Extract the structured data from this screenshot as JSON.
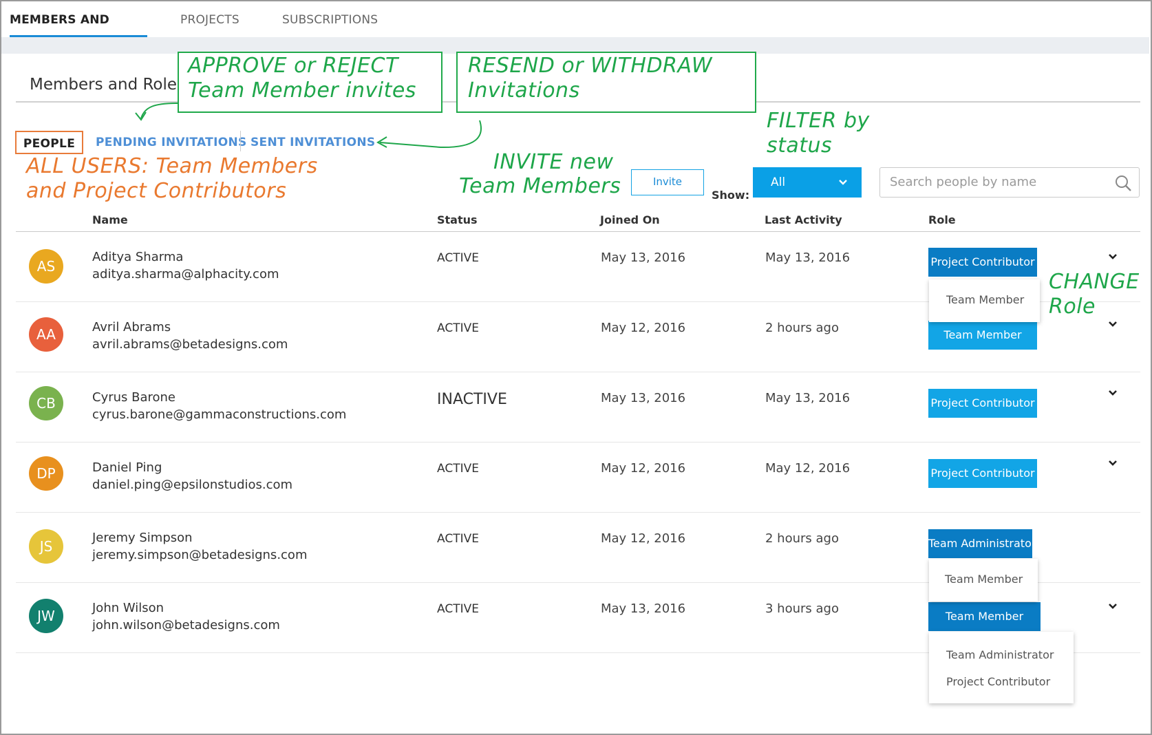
{
  "top_tabs": [
    "MEMBERS AND ROLES",
    "PROJECTS",
    "SUBSCRIPTIONS"
  ],
  "section_title": "Members and Roles",
  "subtabs": {
    "people": "PEOPLE",
    "pending": "PENDING INVITATIONS",
    "sent": "SENT INVITATIONS"
  },
  "toolbar": {
    "invite_label": "Invite",
    "show_label": "Show:",
    "filter_value": "All",
    "search_placeholder": "Search people by name"
  },
  "table": {
    "columns": [
      "Name",
      "Status",
      "Joined On",
      "Last Activity",
      "Role"
    ],
    "rows": [
      {
        "initials": "AS",
        "name": "Aditya Sharma",
        "email": "aditya.sharma@alphacity.com",
        "status": "ACTIVE",
        "joined": "May 13, 2016",
        "last": "May 13, 2016",
        "role": "Project Contributor"
      },
      {
        "initials": "AA",
        "name": "Avril Abrams",
        "email": "avril.abrams@betadesigns.com",
        "status": "ACTIVE",
        "joined": "May 12, 2016",
        "last": "2 hours ago",
        "role": "Team Member"
      },
      {
        "initials": "CB",
        "name": "Cyrus Barone",
        "email": "cyrus.barone@gammaconstructions.com",
        "status": "INACTIVE",
        "joined": "May 13, 2016",
        "last": "May 13, 2016",
        "role": "Project Contributor"
      },
      {
        "initials": "DP",
        "name": "Daniel Ping",
        "email": "daniel.ping@epsilonstudios.com",
        "status": "ACTIVE",
        "joined": "May 12, 2016",
        "last": "May 12, 2016",
        "role": "Project Contributor"
      },
      {
        "initials": "JS",
        "name": "Jeremy Simpson",
        "email": "jeremy.simpson@betadesigns.com",
        "status": "ACTIVE",
        "joined": "May 12, 2016",
        "last": "2 hours ago",
        "role": "Team Administrator"
      },
      {
        "initials": "JW",
        "name": "John Wilson",
        "email": "john.wilson@betadesigns.com",
        "status": "ACTIVE",
        "joined": "May 13, 2016",
        "last": "3 hours ago",
        "role": "Team Member"
      }
    ]
  },
  "dropdowns": {
    "row1": [
      "Team Member"
    ],
    "row5": [
      "Team Member"
    ],
    "row6": [
      "Team Administrator",
      "Project Contributor"
    ]
  },
  "annotations": {
    "approve_1": "APPROVE or REJECT",
    "approve_2": "Team Member invites",
    "resend_1": "RESEND or WITHDRAW",
    "resend_2": "Invitations",
    "filter_1": "FILTER by",
    "filter_2": "status",
    "invite_1": "INVITE new",
    "invite_2": "Team Members",
    "allusers_1": "ALL USERS: Team Members",
    "allusers_2": "and Project Contributors",
    "change_1": "CHANGE",
    "change_2": "Role"
  },
  "colors": {
    "accent": "#0aa0e6",
    "accent_dark": "#0a7cc4",
    "annotation_green": "#1ea64a",
    "annotation_orange": "#e9792f",
    "avatars": [
      "#e9a820",
      "#e8603c",
      "#7ab24e",
      "#e8901e",
      "#e6c53a",
      "#12806e"
    ]
  },
  "icons": [
    "search-icon",
    "chevron-down-icon"
  ]
}
